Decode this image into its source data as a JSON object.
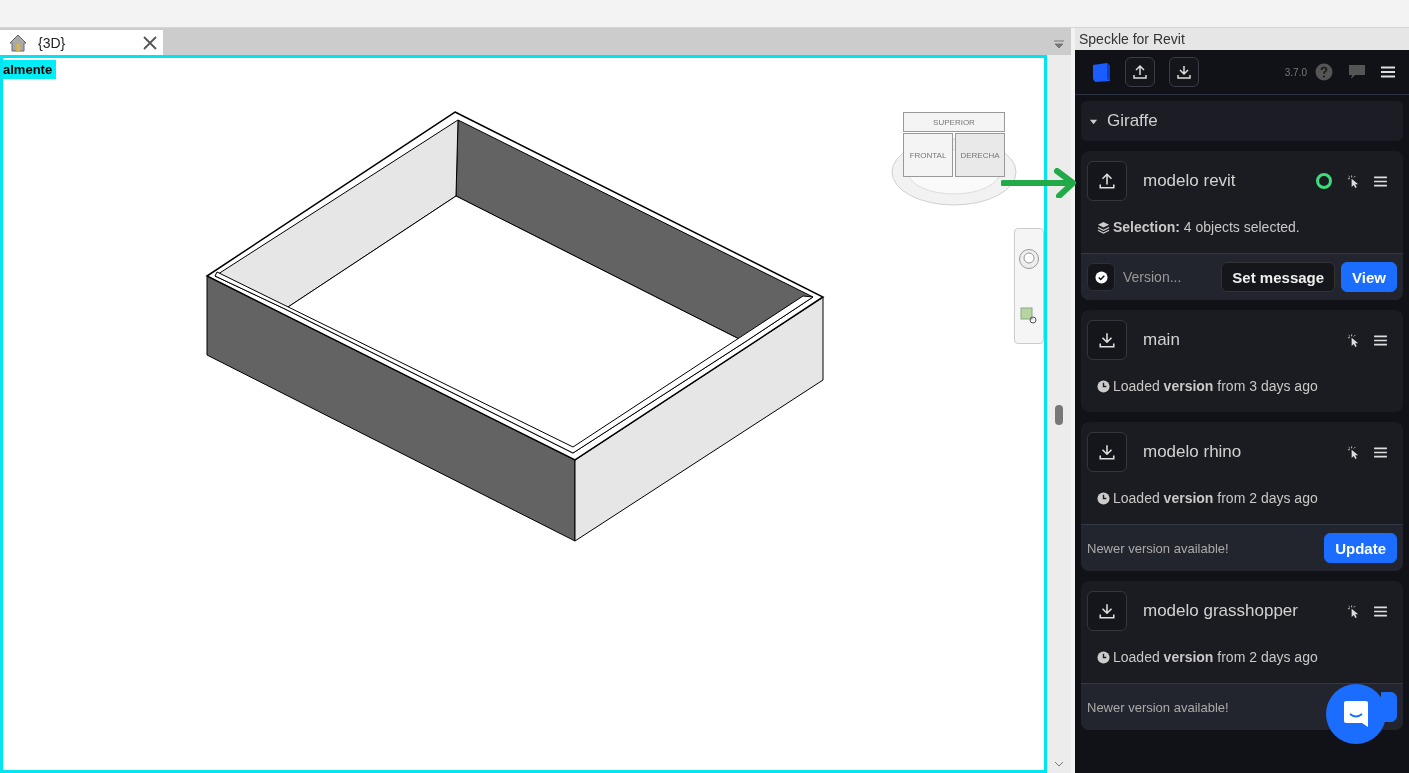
{
  "view_tab": {
    "label": "{3D}",
    "selected": true
  },
  "viewport_label": "almente",
  "viewcube": {
    "top": "SUPERIOR",
    "front": "FRONTAL",
    "right": "DERECHA"
  },
  "panel": {
    "title": "Speckle for Revit",
    "version": "3.7.0"
  },
  "project": {
    "name": "Giraffe",
    "expanded": true
  },
  "models": [
    {
      "kind": "send",
      "name": "modelo revit",
      "live": true,
      "info": "**Selection:** 4 objects selected.",
      "footer": {
        "placeholder": "Version...",
        "buttons": [
          {
            "label": "Set message",
            "kind": "secondary"
          },
          {
            "label": "View",
            "kind": "primary"
          }
        ]
      }
    },
    {
      "kind": "receive",
      "name": "main",
      "live": false,
      "info": "Loaded **version** from 3 days ago"
    },
    {
      "kind": "receive",
      "name": "modelo rhino",
      "live": false,
      "info": "Loaded **version** from 2 days ago",
      "footer": {
        "message": "Newer version available!",
        "buttons": [
          {
            "label": "Update",
            "kind": "primary"
          }
        ]
      }
    },
    {
      "kind": "receive",
      "name": "modelo grasshopper",
      "live": false,
      "info": "Loaded **version** from 2 days ago",
      "footer": {
        "message": "Newer version available!",
        "buttons": [
          {
            "kind": "primary"
          }
        ]
      }
    }
  ]
}
